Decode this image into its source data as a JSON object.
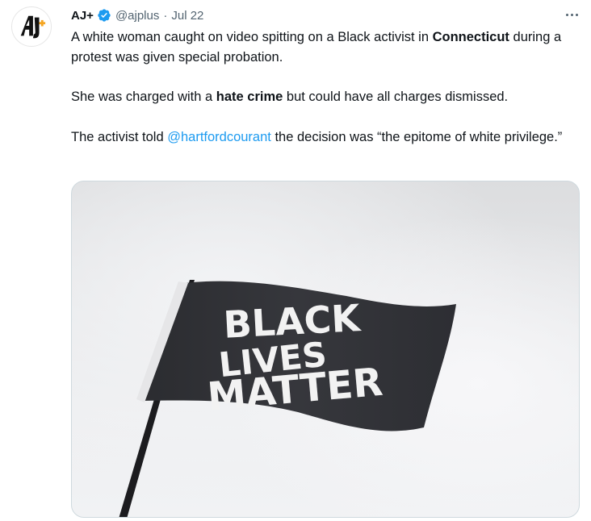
{
  "author": {
    "name": "AJ+",
    "handle": "@ajplus",
    "separator": "·",
    "date": "Jul 22",
    "avatar_text": "AJ+"
  },
  "tweet": {
    "p1": {
      "a": "A white woman caught on video spitting on a Black activist in ",
      "bold": "Connecticut",
      "b": " during a protest was given special probation."
    },
    "p2": {
      "a": "She was charged with a ",
      "bold": "hate crime",
      "b": " but could have all charges dismissed."
    },
    "p3": {
      "a": "The activist told ",
      "mention": "@hartfordcourant",
      "b": " the decision was “the epitome of white privilege.”"
    }
  },
  "media": {
    "flag_line1": "BLACK",
    "flag_line2": "LIVES",
    "flag_line3": "MATTER"
  },
  "icons": {
    "verified": "verified-badge-icon",
    "more": "more-options-icon"
  },
  "colors": {
    "link": "#1d9bf0",
    "secondary_text": "#536471",
    "avatar_accent": "#f5a623"
  }
}
